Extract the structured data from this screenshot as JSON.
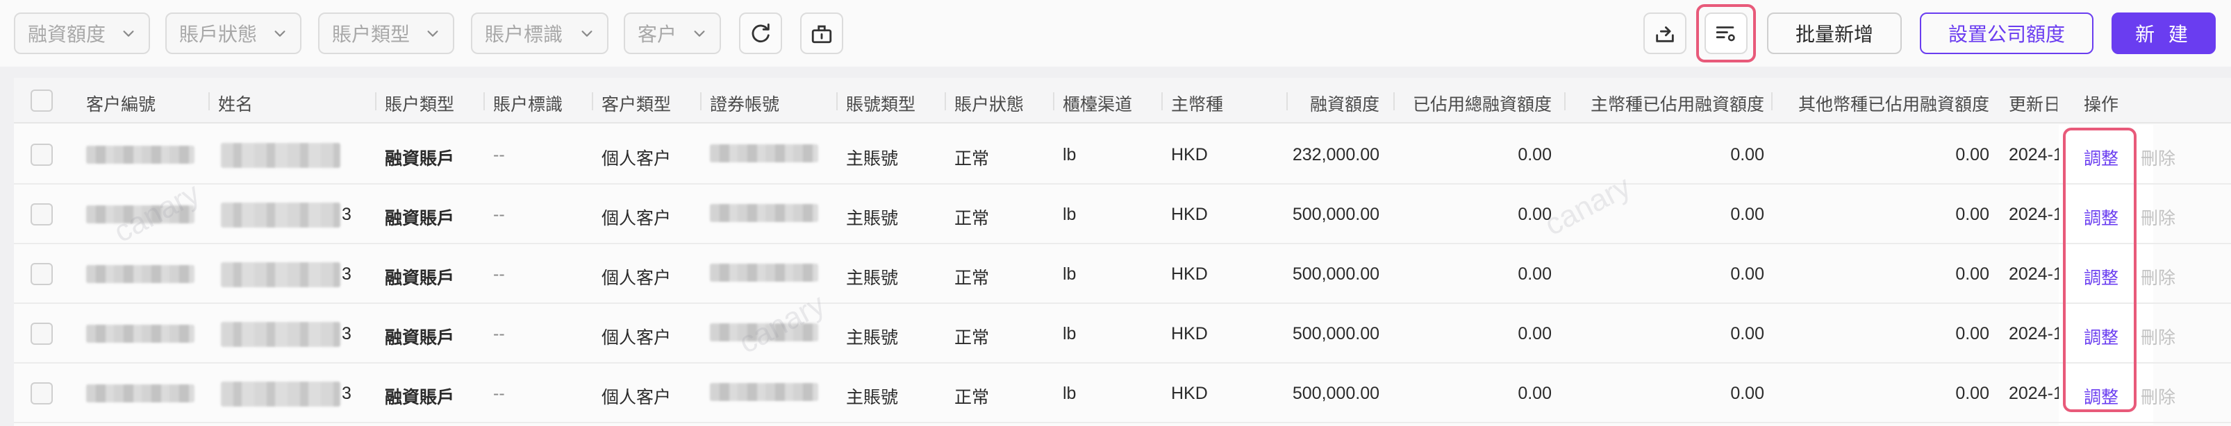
{
  "filters": [
    {
      "label": "融資額度"
    },
    {
      "label": "賬戶狀態"
    },
    {
      "label": "賬户類型"
    },
    {
      "label": "賬户標識"
    },
    {
      "label": "客户"
    }
  ],
  "toolbar": {
    "refresh_icon": "refresh-icon",
    "clear_icon": "clear-icon",
    "export_icon": "export-icon",
    "column_settings_icon": "column-settings-icon",
    "batch_add": "批量新增",
    "set_company_limit": "設置公司額度",
    "new": "新 建"
  },
  "columns": [
    "客户編號",
    "姓名",
    "賬户類型",
    "賬户標識",
    "客户類型",
    "證券帳號",
    "賬號類型",
    "賬户狀態",
    "櫃檯渠道",
    "主幣種",
    "融資額度",
    "已佔用總融資額度",
    "主幣種已佔用融資額度",
    "其他幣種已佔用融資額度",
    "更新日期",
    "操作"
  ],
  "rows": [
    {
      "name_suffix": "",
      "account_type": "融資賬戶",
      "account_tag": "--",
      "customer_type": "個人客户",
      "acct_no_type": "主賬號",
      "status": "正常",
      "channel": "lb",
      "currency": "HKD",
      "limit": "232,000.00",
      "used_total": "0.00",
      "used_main": "0.00",
      "used_other": "0.00",
      "updated": "2024-1",
      "adjust": "調整",
      "delete": "刪除"
    },
    {
      "name_suffix": "3",
      "account_type": "融資賬戶",
      "account_tag": "--",
      "customer_type": "個人客户",
      "acct_no_type": "主賬號",
      "status": "正常",
      "channel": "lb",
      "currency": "HKD",
      "limit": "500,000.00",
      "used_total": "0.00",
      "used_main": "0.00",
      "used_other": "0.00",
      "updated": "2024-1",
      "adjust": "調整",
      "delete": "刪除"
    },
    {
      "name_suffix": "3",
      "account_type": "融資賬戶",
      "account_tag": "--",
      "customer_type": "個人客户",
      "acct_no_type": "主賬號",
      "status": "正常",
      "channel": "lb",
      "currency": "HKD",
      "limit": "500,000.00",
      "used_total": "0.00",
      "used_main": "0.00",
      "used_other": "0.00",
      "updated": "2024-1",
      "adjust": "調整",
      "delete": "刪除"
    },
    {
      "name_suffix": "3",
      "account_type": "融資賬戶",
      "account_tag": "--",
      "customer_type": "個人客户",
      "acct_no_type": "主賬號",
      "status": "正常",
      "channel": "lb",
      "currency": "HKD",
      "limit": "500,000.00",
      "used_total": "0.00",
      "used_main": "0.00",
      "used_other": "0.00",
      "updated": "2024-1",
      "adjust": "調整",
      "delete": "刪除"
    },
    {
      "name_suffix": "3",
      "account_type": "融資賬戶",
      "account_tag": "--",
      "customer_type": "個人客户",
      "acct_no_type": "主賬號",
      "status": "正常",
      "channel": "lb",
      "currency": "HKD",
      "limit": "500,000.00",
      "used_total": "0.00",
      "used_main": "0.00",
      "used_other": "0.00",
      "updated": "2024-1",
      "adjust": "調整",
      "delete": "刪除"
    }
  ],
  "watermark": "canary",
  "colors": {
    "accent": "#6a3df0",
    "highlight": "#e85a7a"
  }
}
